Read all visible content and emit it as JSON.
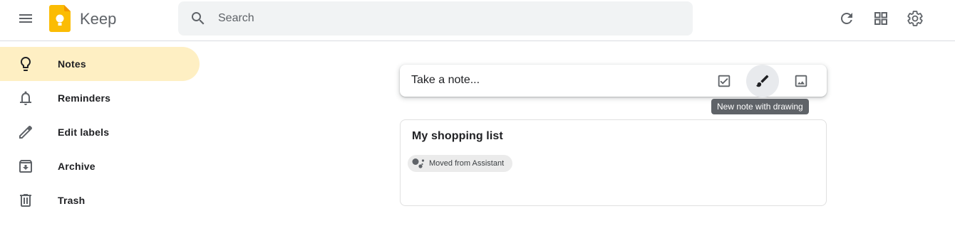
{
  "header": {
    "app_title": "Keep",
    "search_placeholder": "Search",
    "icons": [
      "menu-icon",
      "keep-logo",
      "search-icon",
      "refresh-icon",
      "grid-view-icon",
      "settings-icon"
    ]
  },
  "colors": {
    "active_nav_bg": "#feefc3",
    "logo_yellow": "#fbbc04",
    "search_bg": "#f1f3f4",
    "tooltip_bg": "#5f6368"
  },
  "sidebar": {
    "items": [
      {
        "label": "Notes",
        "icon": "lightbulb-icon",
        "active": true
      },
      {
        "label": "Reminders",
        "icon": "bell-icon",
        "active": false
      },
      {
        "label": "Edit labels",
        "icon": "pencil-icon",
        "active": false
      },
      {
        "label": "Archive",
        "icon": "archive-icon",
        "active": false
      },
      {
        "label": "Trash",
        "icon": "trash-icon",
        "active": false
      }
    ]
  },
  "take_note": {
    "placeholder": "Take a note...",
    "icons": [
      "checkbox-icon",
      "brush-icon",
      "image-icon"
    ],
    "tooltip": "New note with drawing"
  },
  "notes": [
    {
      "title": "My shopping list",
      "chip": "Moved from Assistant"
    }
  ]
}
